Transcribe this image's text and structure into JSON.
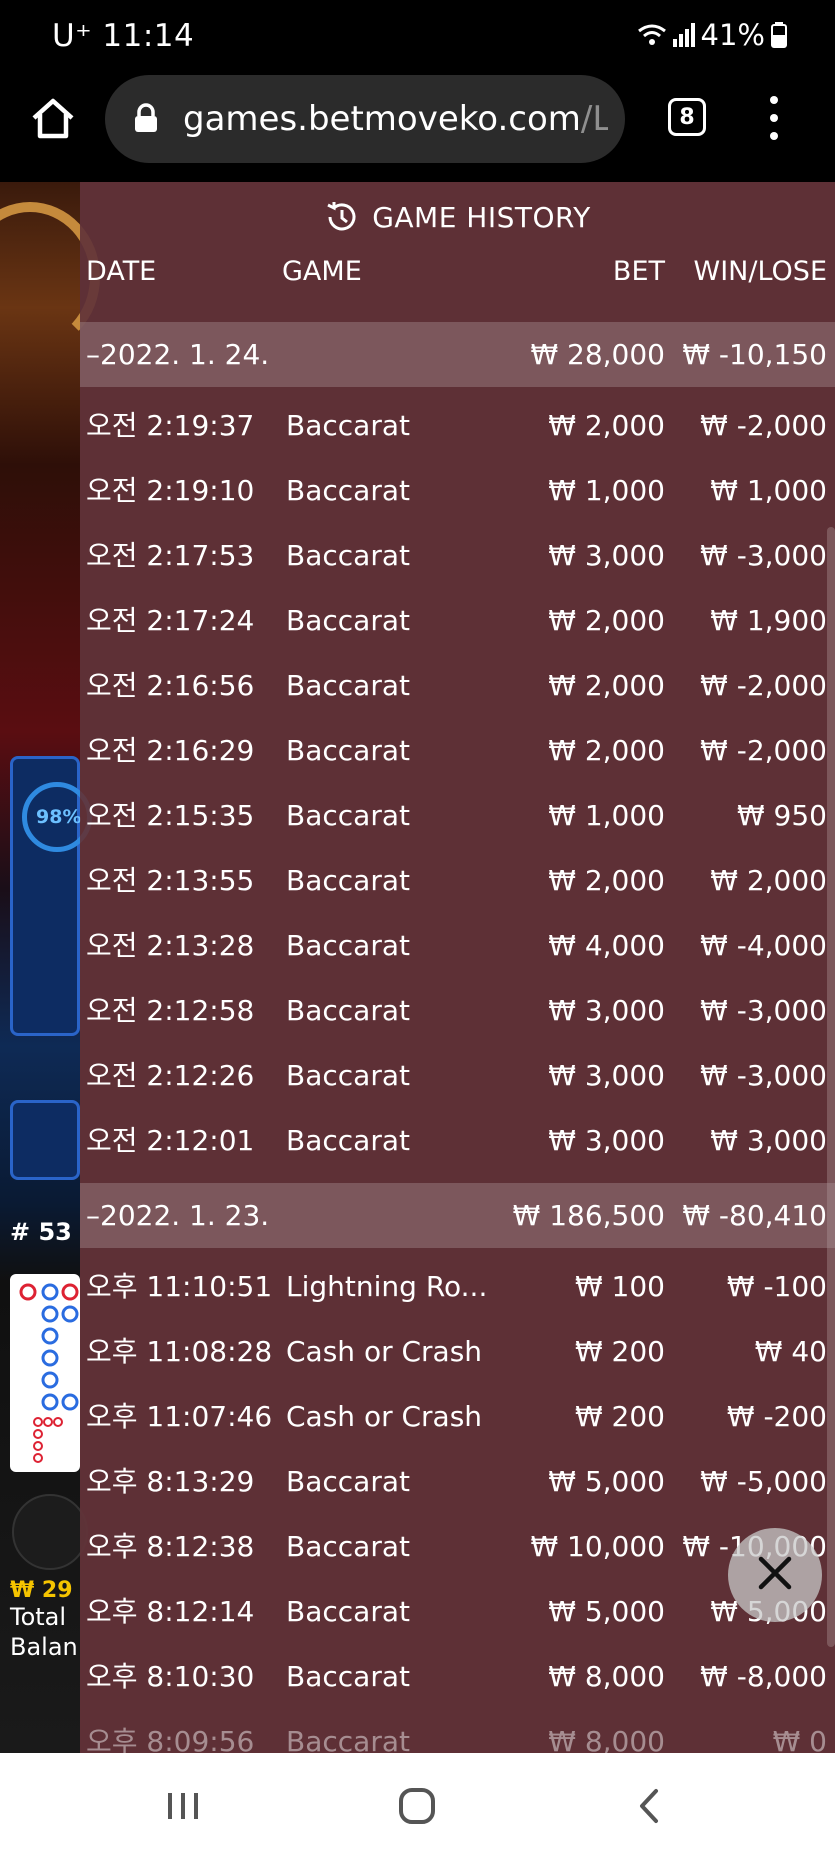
{
  "status_bar": {
    "carrier_time": "U⁺ 11:14",
    "battery": "41%",
    "icons": [
      "wifi-icon",
      "signal-icon",
      "battery-icon"
    ]
  },
  "browser": {
    "url_host": "games.betmoveko.com",
    "url_path": "/Lau",
    "tab_count": "8",
    "icons": [
      "home-icon",
      "lock-icon",
      "tabs-icon",
      "more-menu-icon"
    ]
  },
  "background": {
    "progress_label": "98%",
    "round_label": "# 53",
    "balance_label": "₩ 29",
    "total_label_line1": "Total",
    "total_label_line2": "Balan"
  },
  "history": {
    "title": "GAME HISTORY",
    "columns": {
      "date": "DATE",
      "game": "GAME",
      "bet": "BET",
      "win": "WIN/LOSE"
    },
    "groups": [
      {
        "date": "–2022. 1. 24.",
        "bet_total": "₩ 28,000",
        "win_total": "₩ -10,150",
        "rows": [
          {
            "time": "오전 2:19:37",
            "game": "Baccarat",
            "bet": "₩ 2,000",
            "win": "₩ -2,000"
          },
          {
            "time": "오전 2:19:10",
            "game": "Baccarat",
            "bet": "₩ 1,000",
            "win": "₩ 1,000"
          },
          {
            "time": "오전 2:17:53",
            "game": "Baccarat",
            "bet": "₩ 3,000",
            "win": "₩ -3,000"
          },
          {
            "time": "오전 2:17:24",
            "game": "Baccarat",
            "bet": "₩ 2,000",
            "win": "₩ 1,900"
          },
          {
            "time": "오전 2:16:56",
            "game": "Baccarat",
            "bet": "₩ 2,000",
            "win": "₩ -2,000"
          },
          {
            "time": "오전 2:16:29",
            "game": "Baccarat",
            "bet": "₩ 2,000",
            "win": "₩ -2,000"
          },
          {
            "time": "오전 2:15:35",
            "game": "Baccarat",
            "bet": "₩ 1,000",
            "win": "₩ 950"
          },
          {
            "time": "오전 2:13:55",
            "game": "Baccarat",
            "bet": "₩ 2,000",
            "win": "₩ 2,000"
          },
          {
            "time": "오전 2:13:28",
            "game": "Baccarat",
            "bet": "₩ 4,000",
            "win": "₩ -4,000"
          },
          {
            "time": "오전 2:12:58",
            "game": "Baccarat",
            "bet": "₩ 3,000",
            "win": "₩ -3,000"
          },
          {
            "time": "오전 2:12:26",
            "game": "Baccarat",
            "bet": "₩ 3,000",
            "win": "₩ -3,000"
          },
          {
            "time": "오전 2:12:01",
            "game": "Baccarat",
            "bet": "₩ 3,000",
            "win": "₩ 3,000"
          }
        ]
      },
      {
        "date": "–2022. 1. 23.",
        "bet_total": "₩ 186,500",
        "win_total": "₩ -80,410",
        "rows": [
          {
            "time": "오후 11:10:51",
            "game": "Lightning Ro...",
            "bet": "₩ 100",
            "win": "₩ -100"
          },
          {
            "time": "오후 11:08:28",
            "game": "Cash or Crash",
            "bet": "₩ 200",
            "win": "₩ 40"
          },
          {
            "time": "오후 11:07:46",
            "game": "Cash or Crash",
            "bet": "₩ 200",
            "win": "₩ -200"
          },
          {
            "time": "오후 8:13:29",
            "game": "Baccarat",
            "bet": "₩ 5,000",
            "win": "₩ -5,000"
          },
          {
            "time": "오후 8:12:38",
            "game": "Baccarat",
            "bet": "₩ 10,000",
            "win": "₩ -10,000"
          },
          {
            "time": "오후 8:12:14",
            "game": "Baccarat",
            "bet": "₩ 5,000",
            "win": "₩ 5,000"
          },
          {
            "time": "오후 8:10:30",
            "game": "Baccarat",
            "bet": "₩ 8,000",
            "win": "₩ -8,000"
          },
          {
            "time": "오후 8:09:56",
            "game": "Baccarat",
            "bet": "₩ 8,000",
            "win": "₩ 0"
          }
        ]
      }
    ]
  },
  "nav_bar": {
    "icons": [
      "recent-apps-icon",
      "home-nav-icon",
      "back-icon"
    ]
  }
}
